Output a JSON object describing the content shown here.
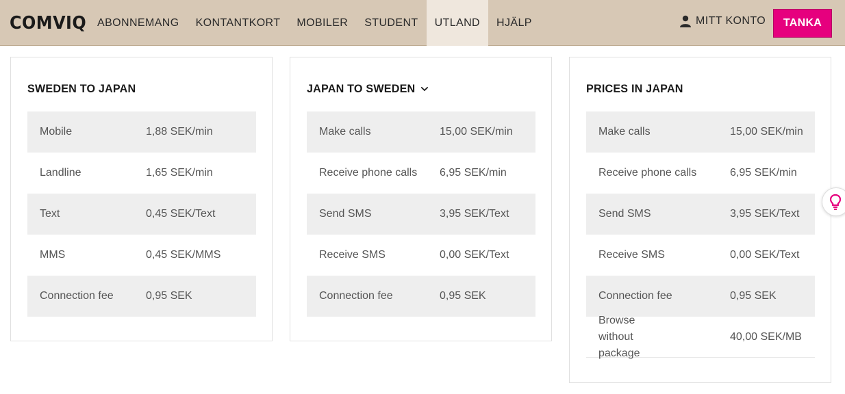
{
  "brand": {
    "logo_text": "COMVIQ",
    "accent": "#e6007e",
    "nav_bg": "#d7c8b5"
  },
  "nav": {
    "items": [
      {
        "label": "ABONNEMANG",
        "active": false
      },
      {
        "label": "KONTANTKORT",
        "active": false
      },
      {
        "label": "MOBILER",
        "active": false
      },
      {
        "label": "STUDENT",
        "active": false
      },
      {
        "label": "UTLAND",
        "active": true
      },
      {
        "label": "HJÄLP",
        "active": false
      }
    ],
    "account_label": "MITT KONTO",
    "account_icon": "user-icon",
    "cta_label": "TANKA"
  },
  "cards": [
    {
      "title": "SWEDEN TO JAPAN",
      "has_dropdown": false,
      "rows": [
        {
          "label": "Mobile",
          "value": "1,88 SEK/min"
        },
        {
          "label": "Landline",
          "value": "1,65 SEK/min"
        },
        {
          "label": "Text",
          "value": "0,45 SEK/Text"
        },
        {
          "label": "MMS",
          "value": "0,45 SEK/MMS"
        },
        {
          "label": "Connection fee",
          "value": "0,95 SEK"
        }
      ]
    },
    {
      "title": "JAPAN TO SWEDEN",
      "has_dropdown": true,
      "rows": [
        {
          "label": "Make calls",
          "value": "15,00 SEK/min"
        },
        {
          "label": "Receive phone calls",
          "value": "6,95 SEK/min"
        },
        {
          "label": "Send SMS",
          "value": "3,95 SEK/Text"
        },
        {
          "label": "Receive SMS",
          "value": "0,00 SEK/Text"
        },
        {
          "label": "Connection fee",
          "value": "0,95 SEK"
        }
      ]
    },
    {
      "title": "PRICES IN JAPAN",
      "has_dropdown": false,
      "rows": [
        {
          "label": "Make calls",
          "value": "15,00 SEK/min"
        },
        {
          "label": "Receive phone calls",
          "value": "6,95 SEK/min"
        },
        {
          "label": "Send SMS",
          "value": "3,95 SEK/Text"
        },
        {
          "label": "Receive SMS",
          "value": "0,00 SEK/Text"
        },
        {
          "label": "Connection fee",
          "value": "0,95 SEK"
        },
        {
          "label": "Browse without package",
          "value": "40,00 SEK/MB"
        }
      ]
    }
  ],
  "help_icon": "lightbulb-icon"
}
